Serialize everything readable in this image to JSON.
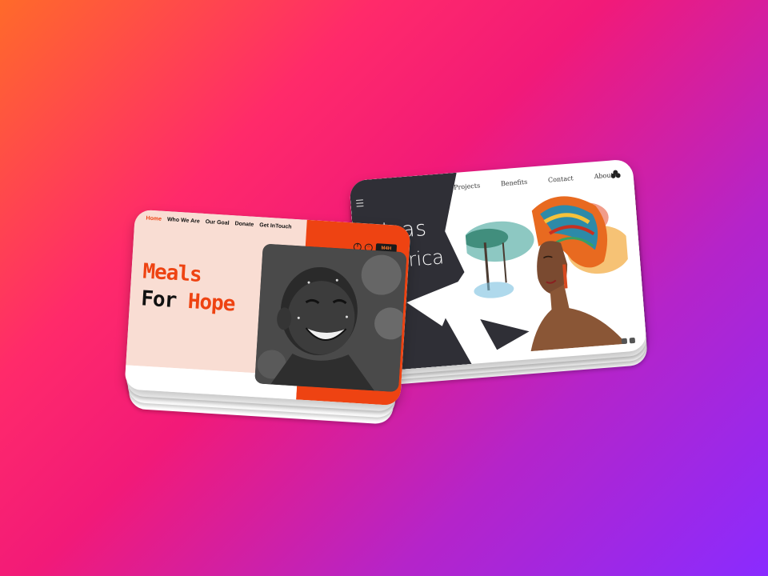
{
  "right_card": {
    "menu_icon": "hamburger-menu-icon",
    "title_line1": "Ideas",
    "title_line2": "frica",
    "nav": [
      "Projects",
      "Benefits",
      "Contact",
      "About"
    ],
    "logo_icon": "tree-logo-icon",
    "hero_image": "african-woman-headwrap-illustration",
    "social_icons": [
      "instagram-icon",
      "facebook-icon"
    ],
    "colors": {
      "dark_panel": "#2f2f36",
      "background": "#ffffff"
    }
  },
  "left_card": {
    "nav": [
      "Home",
      "Who We Are",
      "Our Goal",
      "Donate",
      "Get InTouch"
    ],
    "active_nav": "Home",
    "social_icons": [
      "facebook-icon",
      "instagram-icon"
    ],
    "badge_text": "M4H",
    "title_line1": "Meals",
    "title_line2_prefix": "For ",
    "title_line2_accent": "Hope",
    "hero_image": "smiling-child-black-and-white-photo",
    "colors": {
      "pink_panel": "#f9ddd3",
      "orange_panel": "#ee4312",
      "accent": "#ee4312",
      "text": "#111111"
    }
  }
}
